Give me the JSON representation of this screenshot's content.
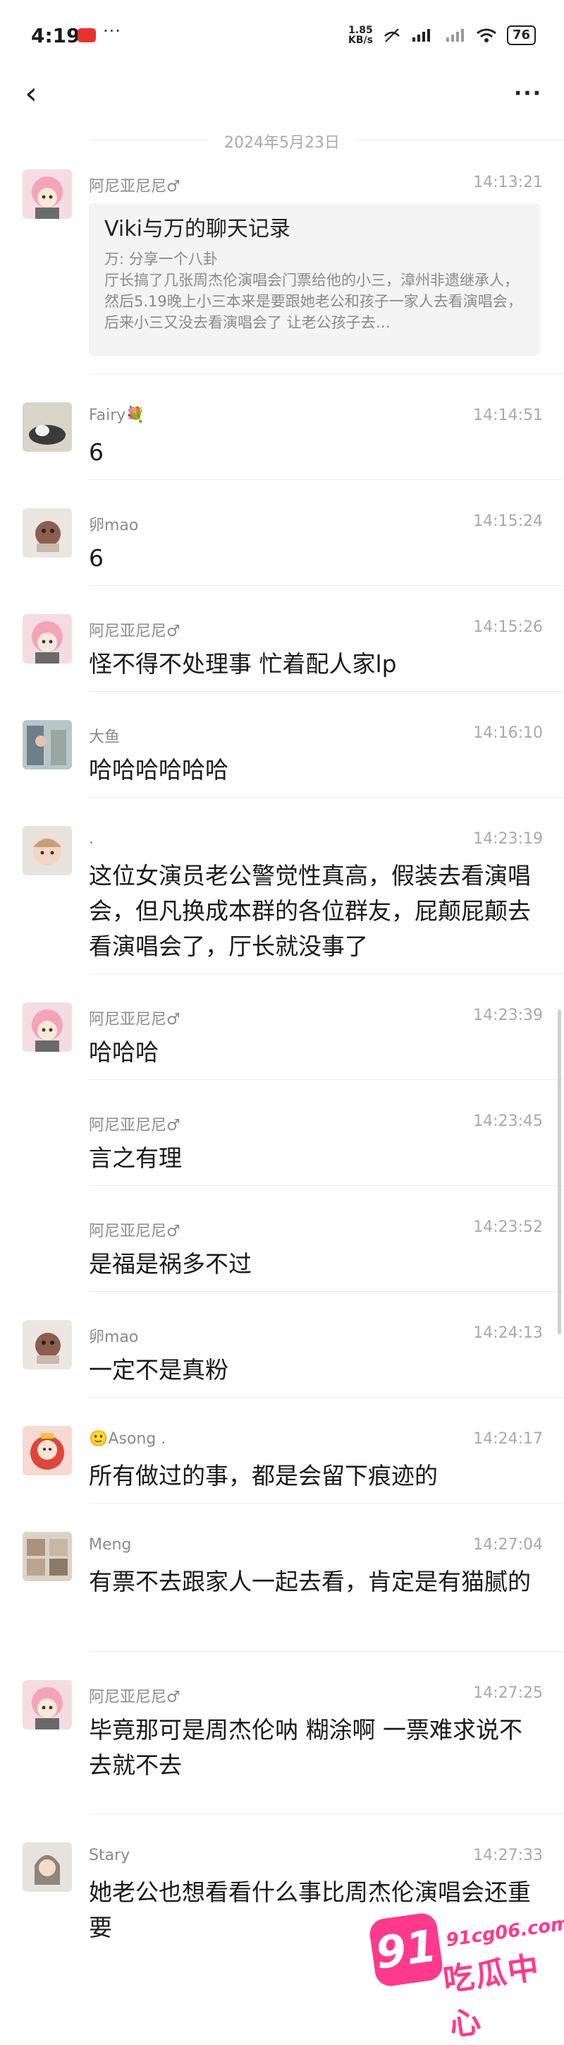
{
  "status_bar": {
    "time": "4:19",
    "notif_dots": "···",
    "net_speed": "1.85\nKB/s",
    "battery": "76"
  },
  "nav": {
    "back_icon": "‹",
    "more_icon": "···"
  },
  "date_separator": "2024年5月23日",
  "messages": [
    {
      "sender": "阿尼亚尼尼♂",
      "time": "14:13:21",
      "card": {
        "title": "Viki与万的聊天记录",
        "sub": "万: 分享一个八卦",
        "desc": "厅长搞了几张周杰伦演唱会门票给他的小三，漳州非遗继承人，然后5.19晚上小三本来是要跟她老公和孩子一家人去看演唱会，后来小三又没去看演唱会了 让老公孩子去…"
      }
    },
    {
      "sender": "Fairy💐",
      "time": "14:14:51",
      "text": "6"
    },
    {
      "sender": "卵mao",
      "time": "14:15:24",
      "text": "6"
    },
    {
      "sender": "阿尼亚尼尼♂",
      "time": "14:15:26",
      "text": "怪不得不处理事 忙着配人家lp"
    },
    {
      "sender": "大鱼",
      "time": "14:16:10",
      "text": "哈哈哈哈哈哈"
    },
    {
      "sender": ".",
      "time": "14:23:19",
      "text": "这位女演员老公警觉性真高，假装去看演唱会，但凡换成本群的各位群友，屁颠屁颠去看演唱会了，厅长就没事了"
    },
    {
      "sender": "阿尼亚尼尼♂",
      "time": "14:23:39",
      "text": "哈哈哈"
    },
    {
      "sender": "阿尼亚尼尼♂",
      "time": "14:23:45",
      "text": "言之有理"
    },
    {
      "sender": "阿尼亚尼尼♂",
      "time": "14:23:52",
      "text": "是福是祸多不过"
    },
    {
      "sender": "卵mao",
      "time": "14:24:13",
      "text": "一定不是真粉"
    },
    {
      "sender": "🙂Asong .",
      "time": "14:24:17",
      "text": "所有做过的事，都是会留下痕迹的"
    },
    {
      "sender": "Meng",
      "time": "14:27:04",
      "text": "有票不去跟家人一起去看，肯定是有猫腻的"
    },
    {
      "sender": "阿尼亚尼尼♂",
      "time": "14:27:25",
      "text": "毕竟那可是周杰伦呐 糊涂啊 一票难求说不去就不去"
    },
    {
      "sender": "Stary",
      "time": "14:27:33",
      "text": "她老公也想看看什么事比周杰伦演唱会还重要"
    }
  ],
  "watermark": {
    "num": "91",
    "url": "91cg06.com",
    "cn": "吃瓜中心"
  }
}
